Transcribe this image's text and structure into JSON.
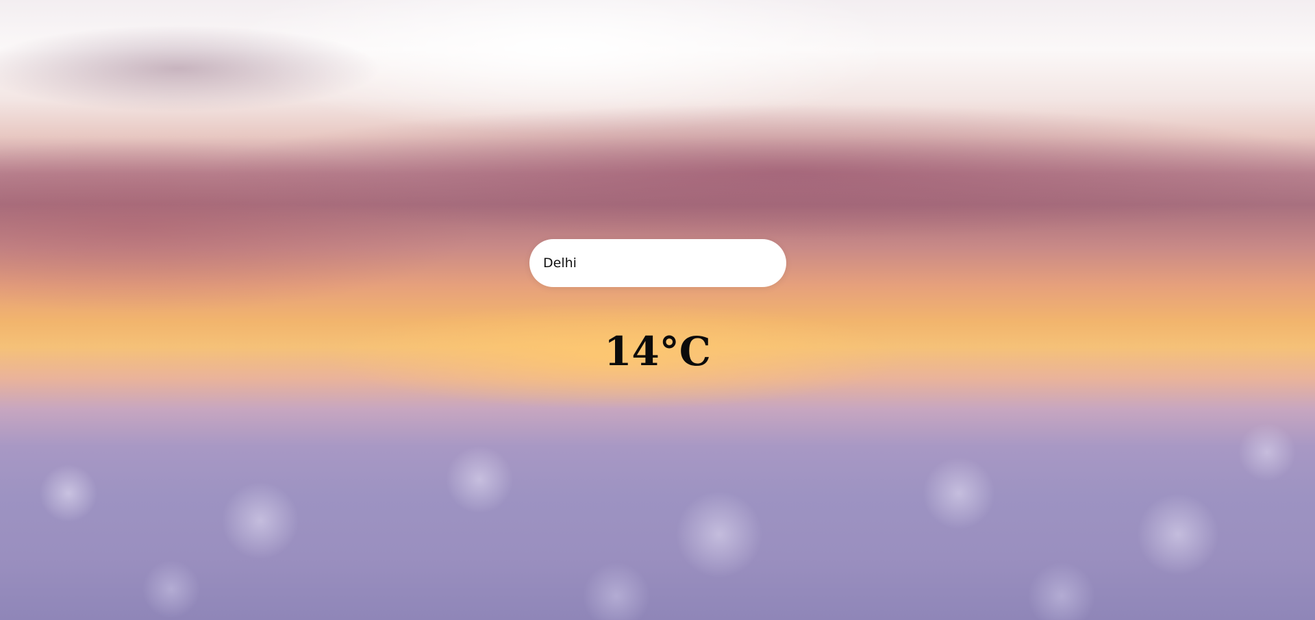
{
  "search": {
    "value": "Delhi",
    "placeholder": ""
  },
  "weather": {
    "temperature": "14°C"
  },
  "colors": {
    "search_background": "#ffffff",
    "text": "#0b0b0b"
  }
}
